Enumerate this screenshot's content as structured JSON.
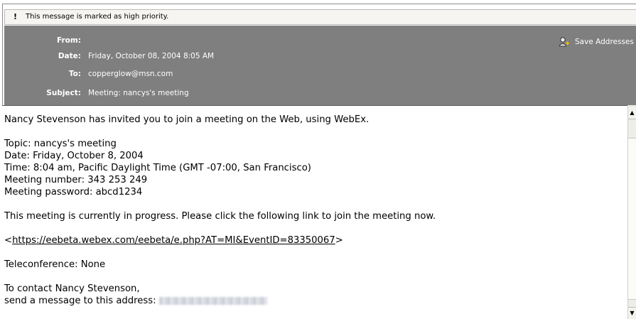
{
  "priority": {
    "icon": "exclamation-icon",
    "message": "This message is marked as high priority."
  },
  "header": {
    "from_label": "From:",
    "from_value": "",
    "date_label": "Date:",
    "date_value": "Friday, October 08, 2004 8:05 AM",
    "to_label": "To:",
    "to_value": "copperglow@msn.com",
    "subject_label": "Subject:",
    "subject_value": "Meeting: nancys's meeting",
    "save_addresses_label": "Save Addresses",
    "save_addresses_icon": "add-contact-icon"
  },
  "body": {
    "intro": "Nancy Stevenson has invited you to join a meeting on the Web, using WebEx.",
    "topic": "Topic: nancys's meeting",
    "date": "Date: Friday, October 8, 2004",
    "time": "Time: 8:04 am, Pacific Daylight Time (GMT -07:00, San Francisco)",
    "meeting_number": "Meeting number: 343 253 249",
    "meeting_password": "Meeting password: abcd1234",
    "progress_note": "This meeting is currently in progress. Please click the following link to join the meeting now.",
    "link_open": "<",
    "link_url": "https://eebeta.webex.com/eebeta/e.php?AT=MI&EventID=83350067",
    "link_close": ">",
    "teleconference": "Teleconference: None",
    "contact_line1": "To contact Nancy Stevenson,",
    "contact_line2": "send a message to this address: "
  },
  "colors": {
    "header_bg": "#7f7f7f",
    "header_text": "#ffffff",
    "priority_bg": "#f6f5f1"
  }
}
